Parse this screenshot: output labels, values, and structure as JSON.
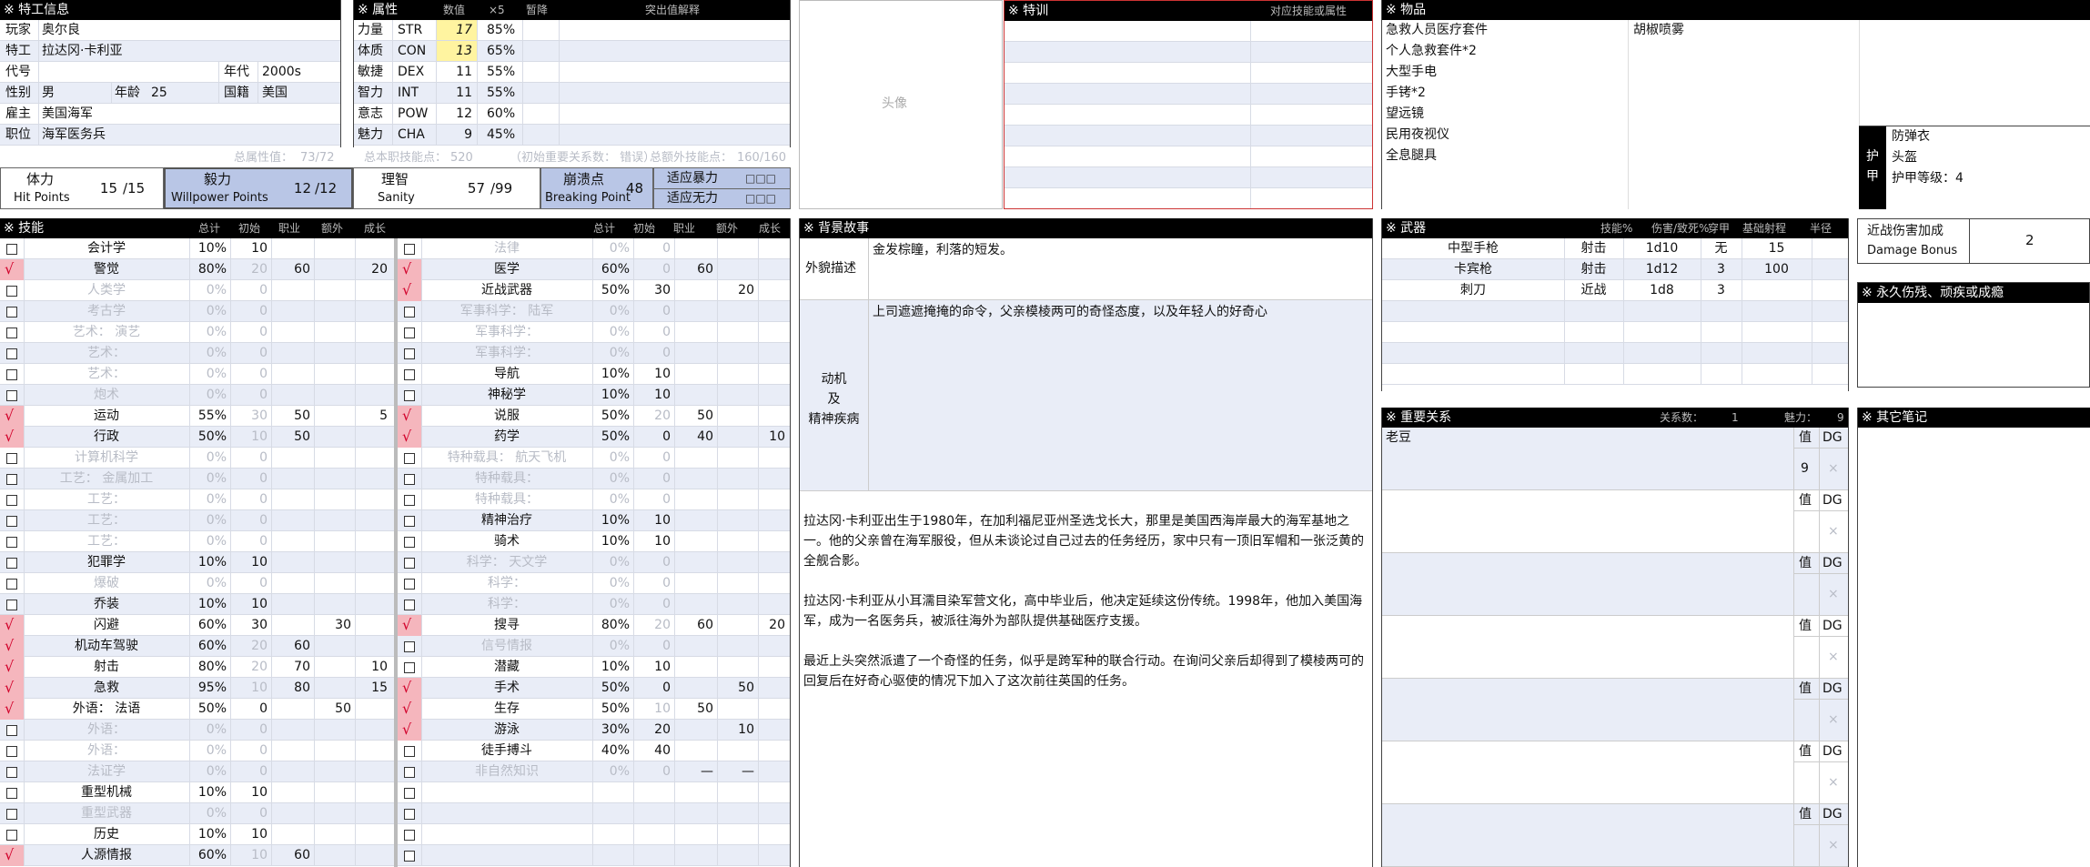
{
  "agent_info": {
    "header": "※ 特工信息",
    "rows": [
      {
        "label": "玩家",
        "value": "奥尔良"
      },
      {
        "label": "特工",
        "value": "拉达冈·卡利亚"
      },
      {
        "label": "代号",
        "value": "",
        "label2": "年代",
        "value2": "2000s"
      },
      {
        "label": "性别",
        "value": "男",
        "label2": "年龄",
        "value2": "25",
        "label3": "国籍",
        "value3": "美国"
      },
      {
        "label": "雇主",
        "value": "美国海军"
      },
      {
        "label": "职位",
        "value": "海军医务兵"
      }
    ]
  },
  "attributes": {
    "header": "※ 属性",
    "col_value": "数值",
    "col_x5": "×5",
    "col_trauma": "暂降",
    "col_note": "突出值解释",
    "rows": [
      {
        "name": "力量",
        "abbr": "STR",
        "value": "17",
        "x5": "85%",
        "hl": true
      },
      {
        "name": "体质",
        "abbr": "CON",
        "value": "13",
        "x5": "65%",
        "hl": true
      },
      {
        "name": "敏捷",
        "abbr": "DEX",
        "value": "11",
        "x5": "55%"
      },
      {
        "name": "智力",
        "abbr": "INT",
        "value": "11",
        "x5": "55%"
      },
      {
        "name": "意志",
        "abbr": "POW",
        "value": "12",
        "x5": "60%"
      },
      {
        "name": "魅力",
        "abbr": "CHA",
        "value": "9",
        "x5": "45%"
      }
    ]
  },
  "totals": {
    "attr_total_label": "总属性值：",
    "attr_total": "73/72",
    "skill_total_label": "总本职技能点：",
    "skill_total": "520",
    "bond_note": "（初始重要关系数：  错误）",
    "extra_total_label": "总额外技能点：",
    "extra_total": "160/160"
  },
  "stats": {
    "hp": {
      "label": "体力",
      "sub": "Hit Points",
      "cur": "15",
      "max": "/15"
    },
    "wp": {
      "label": "毅力",
      "sub": "Willpower Points",
      "cur": "12",
      "max": "/12"
    },
    "san": {
      "label": "理智",
      "sub": "Sanity",
      "cur": "57",
      "max": "/99"
    },
    "bp": {
      "label": "崩溃点",
      "sub": "Breaking Point",
      "val": "48"
    },
    "adapt1": {
      "label": "适应暴力",
      "boxes": "□□□"
    },
    "adapt2": {
      "label": "适应无力",
      "boxes": "□□□"
    }
  },
  "portrait": {
    "label": "头像"
  },
  "training": {
    "header": "※ 特训",
    "col": "对应技能或属性"
  },
  "items": {
    "header": "※ 物品",
    "col1": [
      "急救人员医疗套件",
      "个人急救套件*2",
      "大型手电",
      "手铐*2",
      "望远镜",
      "民用夜视仪",
      "全息腿具"
    ],
    "col2": [
      "胡椒喷雾"
    ]
  },
  "armor": {
    "label1": "护",
    "label2": "甲",
    "items": [
      "防弹衣",
      "头盔",
      "护甲等级：4"
    ]
  },
  "skills": {
    "header": "※ 技能",
    "cols": [
      "总计",
      "初始",
      "职业",
      "额外",
      "成长"
    ],
    "left": [
      {
        "name": "会计学",
        "total": "10%",
        "base": "10"
      },
      {
        "name": "警觉",
        "total": "80%",
        "base": "20",
        "job": "60",
        "extra": "",
        "grow": "20",
        "checked": true,
        "gbase": true
      },
      {
        "name": "人类学",
        "total": "0%",
        "base": "0",
        "gray": true
      },
      {
        "name": "考古学",
        "total": "0%",
        "base": "0",
        "gray": true
      },
      {
        "name": "艺术：  演艺",
        "total": "0%",
        "base": "0",
        "gray": true
      },
      {
        "name": "艺术：",
        "total": "0%",
        "base": "0",
        "gray": true
      },
      {
        "name": "艺术：",
        "total": "0%",
        "base": "0",
        "gray": true
      },
      {
        "name": "炮术",
        "total": "0%",
        "base": "0",
        "gray": true
      },
      {
        "name": "运动",
        "total": "55%",
        "base": "30",
        "job": "50",
        "grow": "5",
        "checked": true,
        "gbase": true
      },
      {
        "name": "行政",
        "total": "50%",
        "base": "10",
        "job": "50",
        "checked": true,
        "gbase": true
      },
      {
        "name": "计算机科学",
        "total": "0%",
        "base": "0",
        "gray": true
      },
      {
        "name": "工艺：  金属加工",
        "total": "0%",
        "base": "0",
        "gray": true
      },
      {
        "name": "工艺：",
        "total": "0%",
        "base": "0",
        "gray": true
      },
      {
        "name": "工艺：",
        "total": "0%",
        "base": "0",
        "gray": true
      },
      {
        "name": "工艺：",
        "total": "0%",
        "base": "0",
        "gray": true
      },
      {
        "name": "犯罪学",
        "total": "10%",
        "base": "10"
      },
      {
        "name": "爆破",
        "total": "0%",
        "base": "0",
        "gray": true
      },
      {
        "name": "乔装",
        "total": "10%",
        "base": "10"
      },
      {
        "name": "闪避",
        "total": "60%",
        "base": "30",
        "extra": "30",
        "checked": true
      },
      {
        "name": "机动车驾驶",
        "total": "60%",
        "base": "20",
        "job": "60",
        "checked": true,
        "gbase": true
      },
      {
        "name": "射击",
        "total": "80%",
        "base": "20",
        "job": "70",
        "grow": "10",
        "checked": true,
        "gbase": true
      },
      {
        "name": "急救",
        "total": "95%",
        "base": "10",
        "job": "80",
        "grow": "15",
        "checked": true,
        "gbase": true
      },
      {
        "name": "外语：  法语",
        "total": "50%",
        "base": "0",
        "extra": "50",
        "checked": true
      },
      {
        "name": "外语：",
        "total": "0%",
        "base": "0",
        "gray": true
      },
      {
        "name": "外语：",
        "total": "0%",
        "base": "0",
        "gray": true
      },
      {
        "name": "法证学",
        "total": "0%",
        "base": "0",
        "gray": true
      },
      {
        "name": "重型机械",
        "total": "10%",
        "base": "10"
      },
      {
        "name": "重型武器",
        "total": "0%",
        "base": "0",
        "gray": true
      },
      {
        "name": "历史",
        "total": "10%",
        "base": "10"
      },
      {
        "name": "人源情报",
        "total": "60%",
        "base": "10",
        "job": "60",
        "checked": true,
        "gbase": true
      }
    ],
    "right": [
      {
        "name": "法律",
        "total": "0%",
        "base": "0",
        "gray": true
      },
      {
        "name": "医学",
        "total": "60%",
        "base": "0",
        "job": "60",
        "checked": true,
        "gbase": true
      },
      {
        "name": "近战武器",
        "total": "50%",
        "base": "30",
        "extra": "20",
        "checked": true
      },
      {
        "name": "军事科学：  陆军",
        "total": "0%",
        "base": "0",
        "gray": true
      },
      {
        "name": "军事科学：",
        "total": "0%",
        "base": "0",
        "gray": true
      },
      {
        "name": "军事科学：",
        "total": "0%",
        "base": "0",
        "gray": true
      },
      {
        "name": "导航",
        "total": "10%",
        "base": "10"
      },
      {
        "name": "神秘学",
        "total": "10%",
        "base": "10"
      },
      {
        "name": "说服",
        "total": "50%",
        "base": "20",
        "job": "50",
        "checked": true,
        "gbase": true
      },
      {
        "name": "药学",
        "total": "50%",
        "base": "0",
        "job": "40",
        "grow": "10",
        "checked": true
      },
      {
        "name": "特种载具：  航天飞机",
        "total": "0%",
        "base": "0",
        "gray": true
      },
      {
        "name": "特种载具：",
        "total": "0%",
        "base": "0",
        "gray": true
      },
      {
        "name": "特种载具：",
        "total": "0%",
        "base": "0",
        "gray": true
      },
      {
        "name": "精神治疗",
        "total": "10%",
        "base": "10"
      },
      {
        "name": "骑术",
        "total": "10%",
        "base": "10"
      },
      {
        "name": "科学：  天文学",
        "total": "0%",
        "base": "0",
        "gray": true
      },
      {
        "name": "科学：",
        "total": "0%",
        "base": "0",
        "gray": true
      },
      {
        "name": "科学：",
        "total": "0%",
        "base": "0",
        "gray": true
      },
      {
        "name": "搜寻",
        "total": "80%",
        "base": "20",
        "job": "60",
        "grow": "20",
        "checked": true,
        "gbase": true
      },
      {
        "name": "信号情报",
        "total": "0%",
        "base": "0",
        "gray": true
      },
      {
        "name": "潜藏",
        "total": "10%",
        "base": "10"
      },
      {
        "name": "手术",
        "total": "50%",
        "base": "0",
        "extra": "50",
        "checked": true
      },
      {
        "name": "生存",
        "total": "50%",
        "base": "10",
        "job": "50",
        "checked": true,
        "gbase": true
      },
      {
        "name": "游泳",
        "total": "30%",
        "base": "20",
        "extra": "10",
        "checked": true
      },
      {
        "name": "徒手搏斗",
        "total": "40%",
        "base": "40"
      },
      {
        "name": "非自然知识",
        "total": "0%",
        "base": "0",
        "job": "—",
        "extra": "—",
        "gray": true
      },
      {
        "name": "",
        "total": "",
        "base": ""
      },
      {
        "name": "",
        "total": "",
        "base": ""
      },
      {
        "name": "",
        "total": "",
        "base": ""
      },
      {
        "name": "",
        "total": "",
        "base": ""
      }
    ]
  },
  "background": {
    "header": "※ 背景故事",
    "looks_label": "外貌描述",
    "looks": "金发棕瞳，利落的短发。",
    "motive_label": [
      "动机",
      "及",
      "精神疾病"
    ],
    "motive": "上司遮遮掩掩的命令，父亲模棱两可的奇怪态度，以及年轻人的好奇心",
    "story": [
      "拉达冈·卡利亚出生于1980年，在加利福尼亚州圣选戈长大，那里是美国西海岸最大的海军基地之一。他的父亲曾在海军服役，但从未谈论过自己过去的任务经历，家中只有一顶旧军帽和一张泛黄的全舰合影。",
      "拉达冈·卡利亚从小耳濡目染军营文化，高中毕业后，他决定延续这份传统。1998年，他加入美国海军，成为一名医务兵，被派往海外为部队提供基础医疗支援。",
      "最近上头突然派遣了一个奇怪的任务，似乎是跨军种的联合行动。在询问父亲后却得到了模棱两可的回复后在好奇心驱使的情况下加入了这次前往英国的任务。"
    ]
  },
  "weapons": {
    "header": "※ 武器",
    "cols": [
      "技能%",
      "伤害/致死%",
      "穿甲",
      "基础射程",
      "半径"
    ],
    "rows": [
      {
        "name": "中型手枪",
        "skill": "射击",
        "dmg": "1d10",
        "ap": "无",
        "range": "15"
      },
      {
        "name": "卡宾枪",
        "skill": "射击",
        "dmg": "1d12",
        "ap": "3",
        "range": "100"
      },
      {
        "name": "刺刀",
        "skill": "近战",
        "dmg": "1d8",
        "ap": "3",
        "range": ""
      }
    ]
  },
  "melee_bonus": {
    "label": "近战伤害加成",
    "sub": "Damage Bonus",
    "value": "2"
  },
  "injuries": {
    "header": "※ 永久伤残、顽疾或成瘾"
  },
  "bonds": {
    "header": "※ 重要关系",
    "count_label": "关系数：",
    "count": "1",
    "cha_label": "魅力：",
    "cha": "9",
    "val_label": "值",
    "dg_label": "DG",
    "x": "×",
    "rows": [
      {
        "name": "老豆",
        "value": "9"
      },
      {
        "name": "",
        "value": ""
      },
      {
        "name": "",
        "value": ""
      },
      {
        "name": "",
        "value": ""
      },
      {
        "name": "",
        "value": ""
      },
      {
        "name": "",
        "value": ""
      },
      {
        "name": "",
        "value": ""
      }
    ]
  },
  "notes": {
    "header": "※ 其它笔记"
  }
}
